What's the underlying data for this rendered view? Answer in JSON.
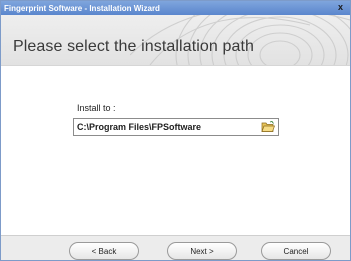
{
  "window": {
    "title": "Fingerprint Software - Installation Wizard",
    "close_label": "x"
  },
  "header": {
    "title": "Please select the installation path"
  },
  "form": {
    "install_label": "Install to :",
    "install_path": "C:\\Program Files\\FPSoftware",
    "browse_icon": "folder-open-icon"
  },
  "footer": {
    "back_label": "< Back",
    "next_label": "Next >",
    "cancel_label": "Cancel"
  }
}
